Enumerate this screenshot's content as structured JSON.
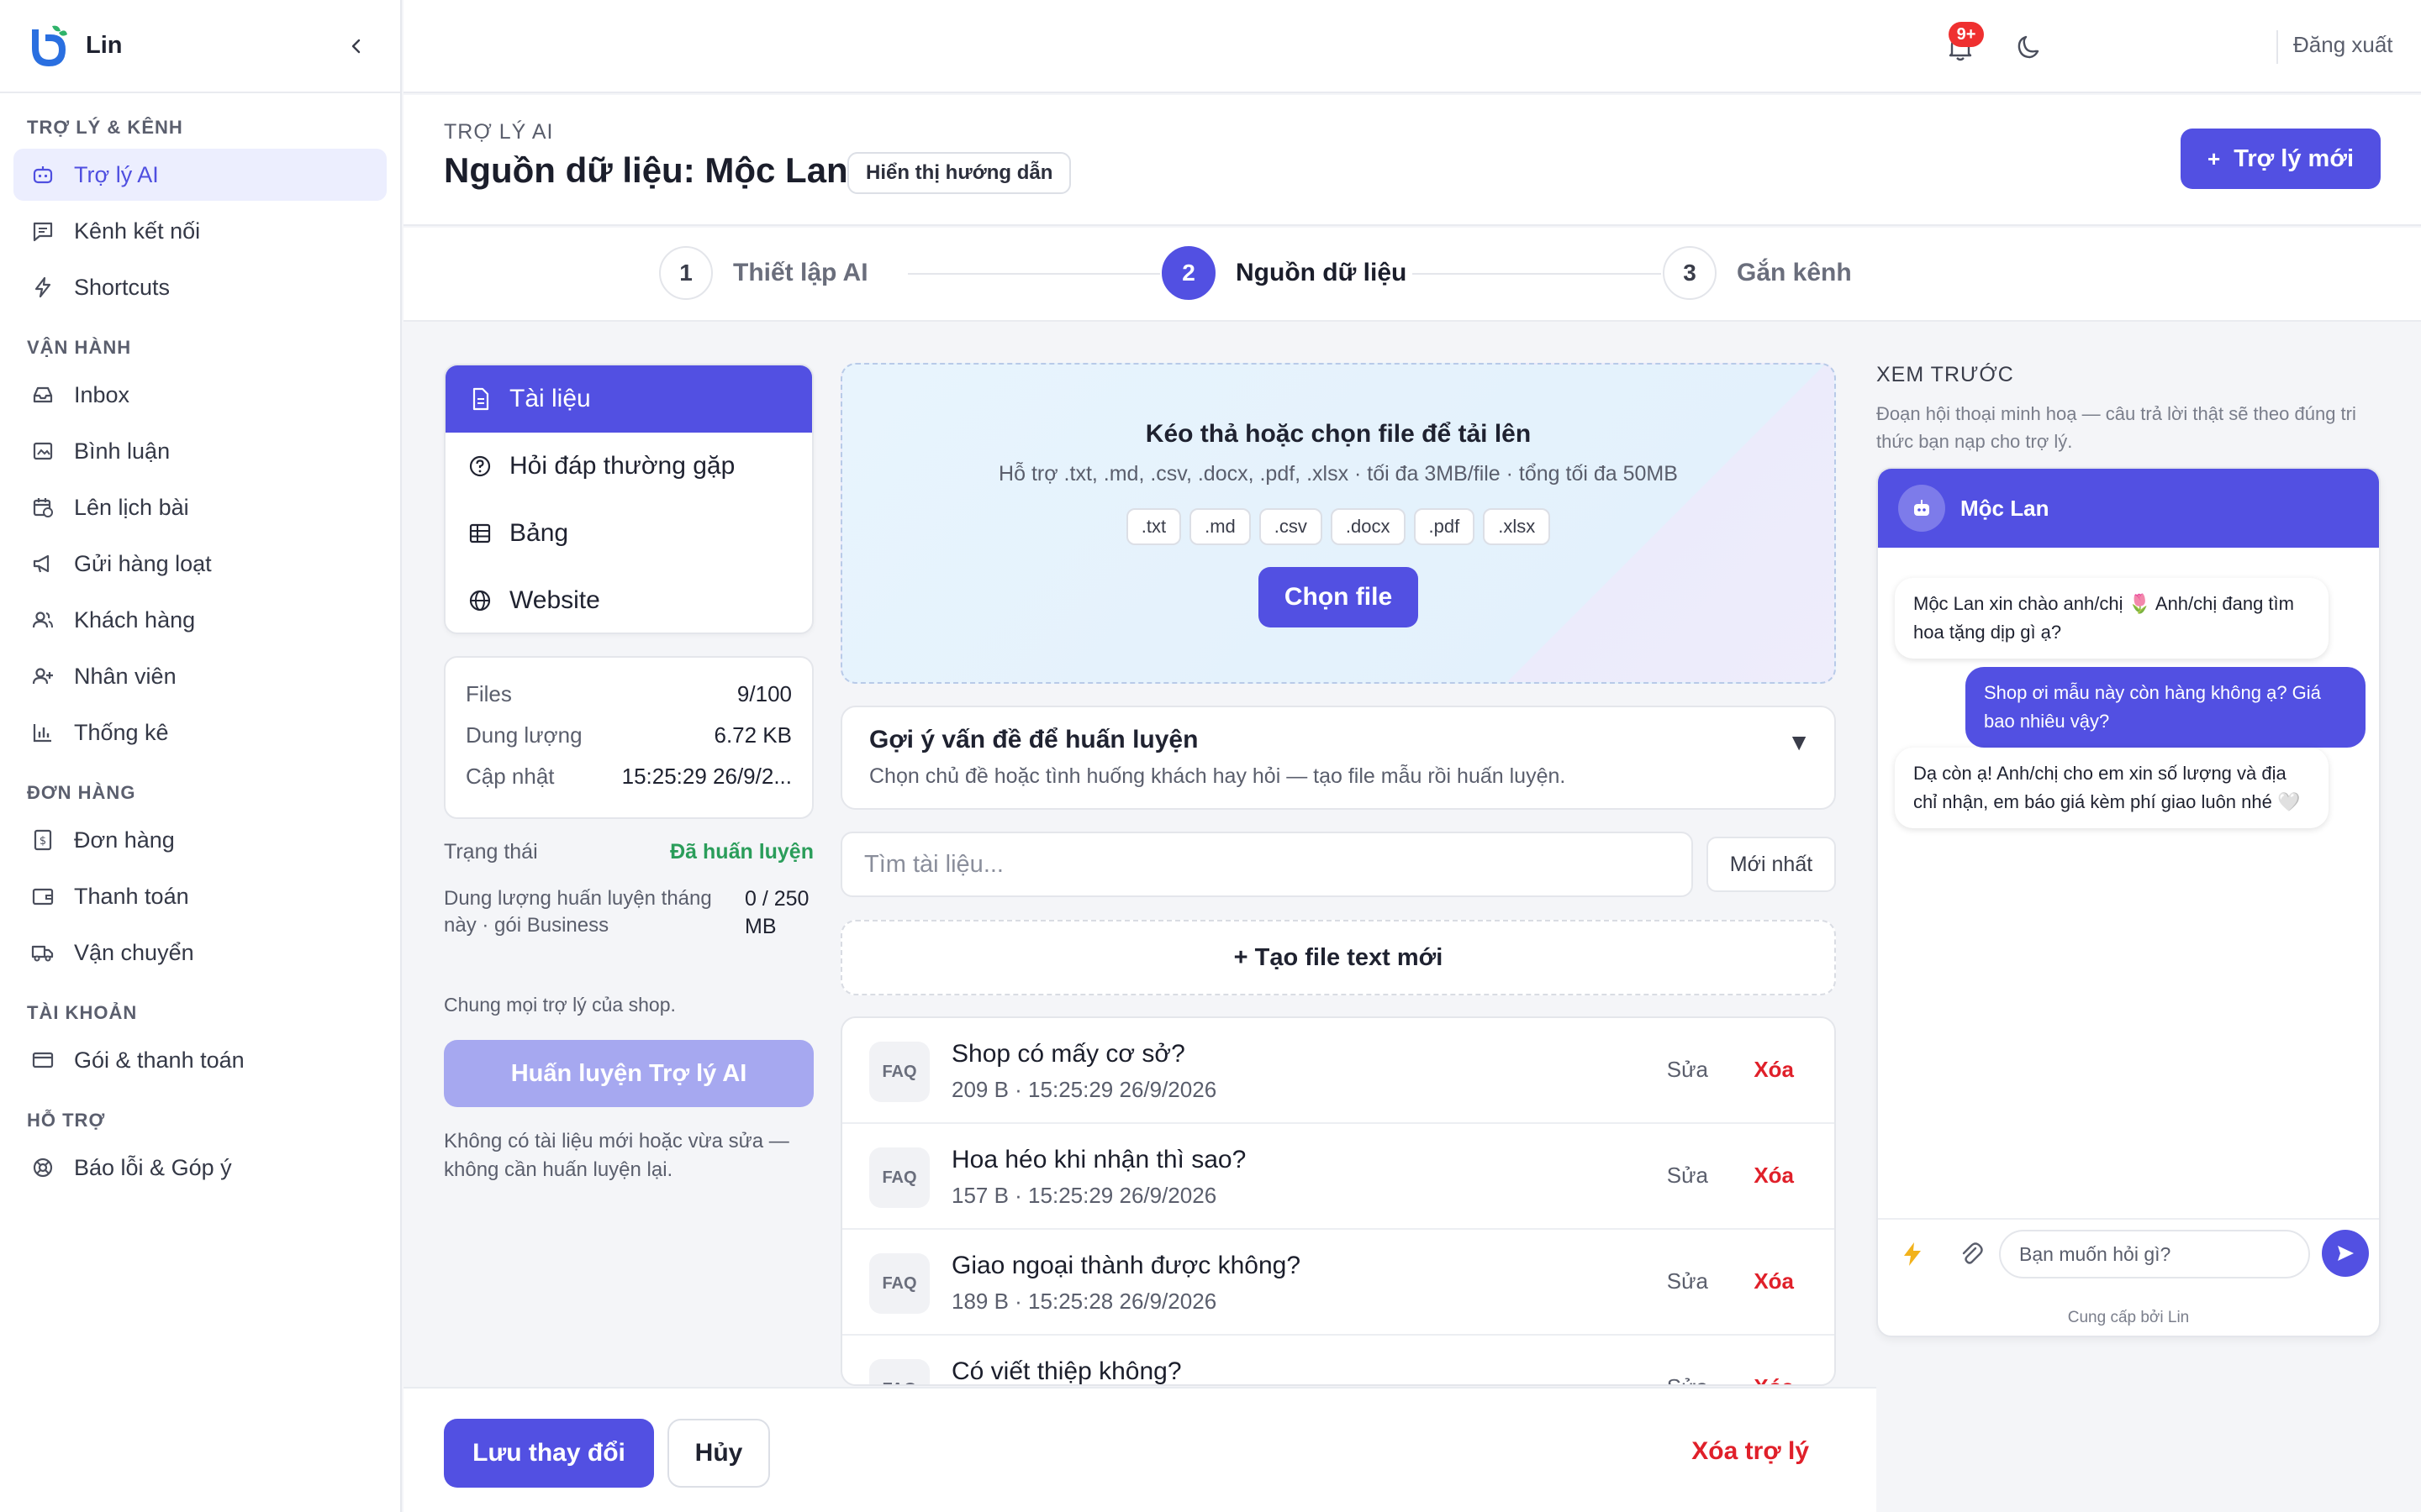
{
  "app": {
    "name": "Lin"
  },
  "sidebar": {
    "groups": [
      {
        "title": "TRỢ LÝ & KÊNH",
        "items": [
          "Trợ lý AI",
          "Kênh kết nối",
          "Shortcuts"
        ]
      },
      {
        "title": "VẬN HÀNH",
        "items": [
          "Inbox",
          "Bình luận",
          "Lên lịch bài",
          "Gửi hàng loạt",
          "Khách hàng",
          "Nhân viên",
          "Thống kê"
        ]
      },
      {
        "title": "ĐƠN HÀNG",
        "items": [
          "Đơn hàng",
          "Thanh toán",
          "Vận chuyển"
        ]
      },
      {
        "title": "TÀI KHOẢN",
        "items": [
          "Gói & thanh toán"
        ]
      },
      {
        "title": "HỖ TRỢ",
        "items": [
          "Báo lỗi & Góp ý"
        ]
      }
    ]
  },
  "topbar": {
    "notifications_badge": "9+",
    "logout_label": "Đăng xuất"
  },
  "header": {
    "kicker": "TRỢ LÝ AI",
    "title": "Nguồn dữ liệu: Mộc Lan",
    "guide_button": "Hiển thị hướng dẫn",
    "new_button": "Trợ lý mới",
    "new_button_plus": "+"
  },
  "stepper": [
    {
      "num": "1",
      "label": "Thiết lập AI"
    },
    {
      "num": "2",
      "label": "Nguồn dữ liệu"
    },
    {
      "num": "3",
      "label": "Gắn kênh"
    }
  ],
  "source_tabs": [
    "Tài liệu",
    "Hỏi đáp thường gặp",
    "Bảng",
    "Website"
  ],
  "stats": {
    "files_label": "Files",
    "files_value": "9/100",
    "size_label": "Dung lượng",
    "size_value": "6.72 KB",
    "updated_label": "Cập nhật",
    "updated_value": "15:25:29 26/9/2..."
  },
  "training": {
    "status_label": "Trạng thái",
    "status_value": "Đã huấn luyện",
    "quota_label": "Dung lượng huấn luyện tháng này · gói Business",
    "quota_value": "0 / 250 MB",
    "shared_note": "Chung mọi trợ lý của shop.",
    "train_button": "Huấn luyện Trợ lý AI",
    "train_note": "Không có tài liệu mới hoặc vừa sửa — không cần huấn luyện lại."
  },
  "upload": {
    "title": "Kéo thả hoặc chọn file để tải lên",
    "subtitle": "Hỗ trợ .txt, .md, .csv, .docx, .pdf, .xlsx · tối đa 3MB/file · tổng tối đa 50MB",
    "types": [
      ".txt",
      ".md",
      ".csv",
      ".docx",
      ".pdf",
      ".xlsx"
    ],
    "choose_button": "Chọn file"
  },
  "suggest": {
    "title": "Gợi ý vấn đề để huấn luyện",
    "subtitle": "Chọn chủ đề hoặc tình huống khách hay hỏi — tạo file mẫu rồi huấn luyện.",
    "caret": "▼"
  },
  "search": {
    "placeholder": "Tìm tài liệu...",
    "sort_label": "Mới nhất"
  },
  "new_text_button": "+ Tạo file text mới",
  "documents": [
    {
      "tag": "FAQ",
      "title": "Shop có mấy cơ sở?",
      "meta": "209 B · 15:25:29 26/9/2026",
      "edit": "Sửa",
      "delete": "Xóa"
    },
    {
      "tag": "FAQ",
      "title": "Hoa héo khi nhận thì sao?",
      "meta": "157 B · 15:25:29 26/9/2026",
      "edit": "Sửa",
      "delete": "Xóa"
    },
    {
      "tag": "FAQ",
      "title": "Giao ngoại thành được không?",
      "meta": "189 B · 15:25:28 26/9/2026",
      "edit": "Sửa",
      "delete": "Xóa"
    },
    {
      "tag": "FAQ",
      "title": "Có viết thiệp không?",
      "meta": "",
      "edit": "Sửa",
      "delete": "Xóa"
    }
  ],
  "footer": {
    "save": "Lưu thay đổi",
    "cancel": "Hủy",
    "delete_assistant": "Xóa trợ lý"
  },
  "preview": {
    "kicker": "XEM TRƯỚC",
    "description": "Đoạn hội thoại minh hoạ — câu trả lời thật sẽ theo đúng tri thức bạn nạp cho trợ lý.",
    "bot_name": "Mộc Lan",
    "messages": [
      {
        "from": "bot",
        "text": "Mộc Lan xin chào anh/chị 🌷 Anh/chị đang tìm hoa tặng dịp gì ạ?"
      },
      {
        "from": "user",
        "text": "Shop ơi mẫu này còn hàng không ạ? Giá bao nhiêu vậy?"
      },
      {
        "from": "bot",
        "text": "Dạ còn ạ! Anh/chị cho em xin số lượng và địa chỉ nhận, em báo giá kèm phí giao luôn nhé 🤍"
      }
    ],
    "input_placeholder": "Bạn muốn hỏi gì?",
    "powered_by": "Cung cấp bởi Lin"
  },
  "colors": {
    "accent": "#5250e2",
    "danger": "#e0202a",
    "success": "#2a9d5a"
  }
}
